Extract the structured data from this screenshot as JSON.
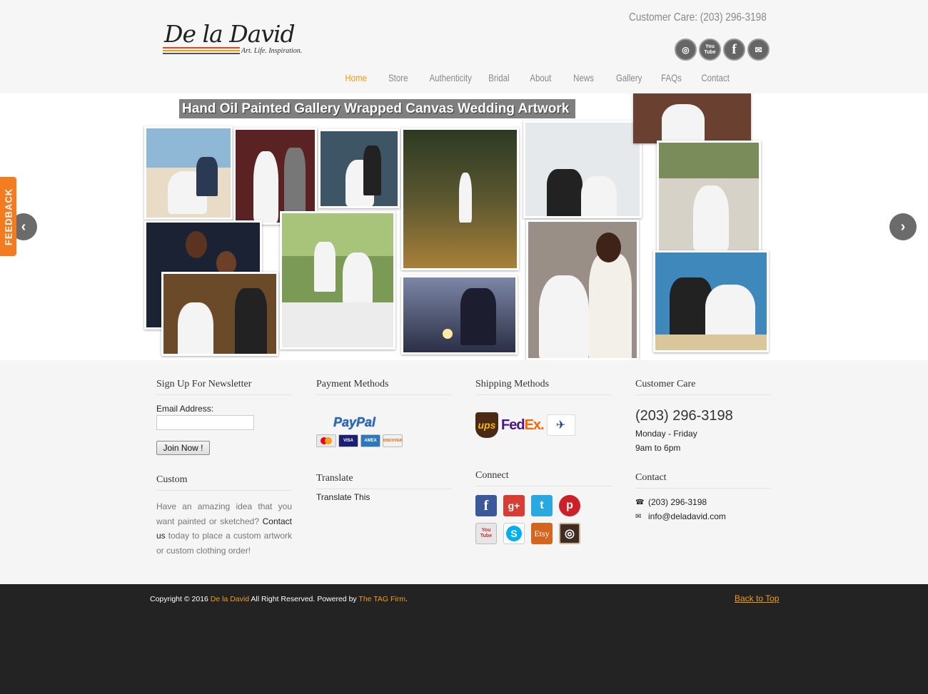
{
  "header": {
    "logo_text": "De la David",
    "logo_tagline": "Art. Life. Inspiration.",
    "customer_care": "Customer Care: (203) 296-3198",
    "social_icons": [
      "instagram-icon",
      "youtube-icon",
      "facebook-icon",
      "email-icon"
    ],
    "youtube_label": "You Tube"
  },
  "nav": {
    "items": [
      "Home",
      "Store",
      "Authenticity",
      "Bridal",
      "About",
      "News",
      "Gallery",
      "FAQs",
      "Contact"
    ],
    "active": "Home"
  },
  "slider": {
    "title": "Hand Oil Painted Gallery Wrapped Canvas Wedding Artwork"
  },
  "feedback": {
    "label": "FEEDBACK"
  },
  "newsletter": {
    "title": "Sign Up For Newsletter",
    "email_label": "Email Address:",
    "email_value": "",
    "button": "Join Now !"
  },
  "custom": {
    "title": "Custom",
    "text_before": "Have an amazing idea that you want painted or sketched?",
    "link": "Contact us",
    "text_after": "today to place a custom artwork or custom clothing order!"
  },
  "payment": {
    "title": "Payment Methods",
    "paypal": "PayPal",
    "cards": [
      "MasterCard",
      "VISA",
      "AMEX",
      "DISCOVER"
    ]
  },
  "translate": {
    "title": "Translate",
    "link": "Translate This"
  },
  "shipping": {
    "title": "Shipping Methods",
    "carriers": [
      "ups",
      "FedEx",
      "UNITED STATES POSTAL SERVICE"
    ]
  },
  "connect": {
    "title": "Connect",
    "networks": [
      {
        "name": "facebook",
        "glyph": "f",
        "color": "#3b5998"
      },
      {
        "name": "google-plus",
        "glyph": "g+",
        "color": "#d73d32"
      },
      {
        "name": "twitter",
        "glyph": "t",
        "color": "#2aa9e0"
      },
      {
        "name": "pinterest",
        "glyph": "p",
        "color": "#cb2027"
      },
      {
        "name": "youtube",
        "glyph": "You Tube",
        "color": "#e6e6e6"
      },
      {
        "name": "skype",
        "glyph": "S",
        "color": "#00aff0"
      },
      {
        "name": "etsy",
        "glyph": "Etsy",
        "color": "#d5641c"
      },
      {
        "name": "instagram",
        "glyph": "◎",
        "color": "#3f2b1f"
      }
    ]
  },
  "customer_care": {
    "title": "Customer Care",
    "phone": "(203) 296-3198",
    "days": "Monday - Friday",
    "hours": "9am to 6pm"
  },
  "contact": {
    "title": "Contact",
    "phone": "(203) 296-3198",
    "email": "info@deladavid.com"
  },
  "footer": {
    "copyright_prefix": "Copyright © 2016",
    "brand": "De la David",
    "rights": "All Right Reserved. Powered by",
    "firm": "The TAG Firm",
    "period": ".",
    "back_to_top": "Back to Top"
  },
  "colors": {
    "accent": "#f39c12",
    "feedback": "#f47c20",
    "footer_bg": "#232323"
  }
}
